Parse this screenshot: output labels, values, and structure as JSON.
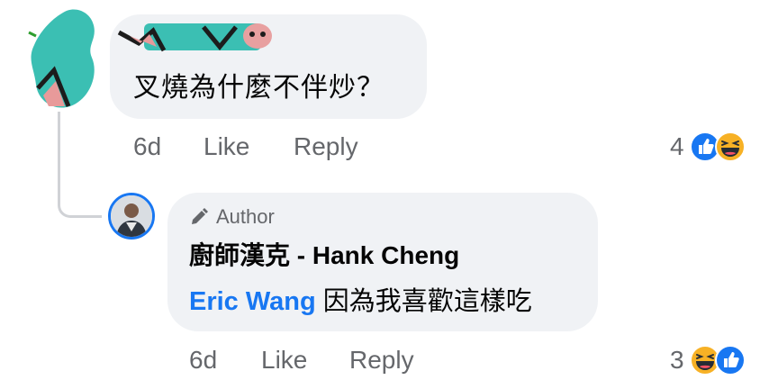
{
  "comment": {
    "text": "叉燒為什麼不伴炒？",
    "time": "6d",
    "like_label": "Like",
    "reply_label": "Reply",
    "reaction_count": "4",
    "reactions": [
      "like-icon",
      "haha-icon"
    ]
  },
  "reply": {
    "author_badge": "Author",
    "author_name": "廚師漢克 - Hank Cheng",
    "mention": "Eric Wang",
    "text": " 因為我喜歡這樣吃",
    "time": "6d",
    "like_label": "Like",
    "reply_label": "Reply",
    "reaction_count": "3",
    "reactions": [
      "haha-icon",
      "like-icon"
    ]
  },
  "colors": {
    "bubble": "#f0f2f5",
    "meta_text": "#65676b",
    "link_blue": "#1877f2",
    "redaction_teal": "#3bbfb3"
  }
}
